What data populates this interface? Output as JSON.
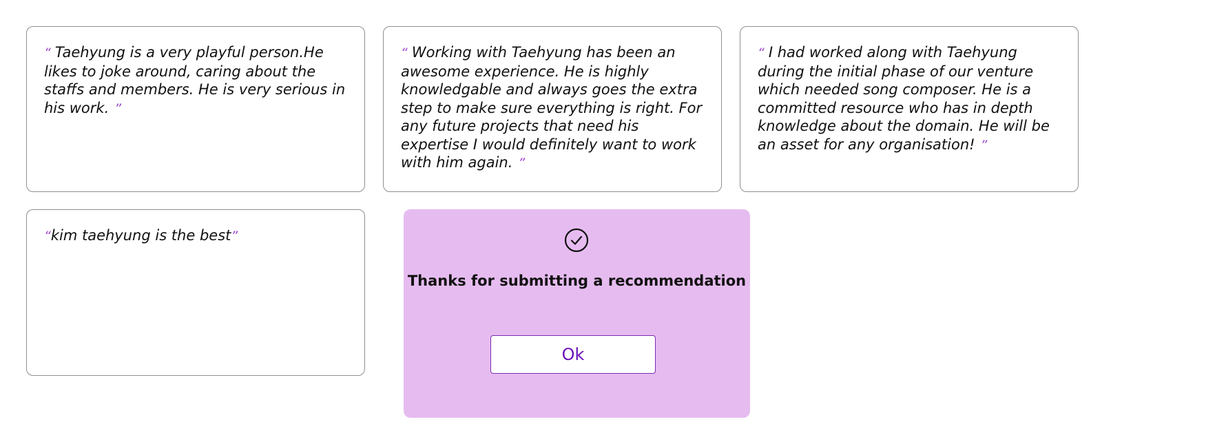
{
  "recommendations": [
    {
      "open_quote": "“",
      "text": "Taehyung is a very playful person.He likes to joke around, caring about the staffs and members. He is very serious in his work.",
      "close_quote": "”"
    },
    {
      "open_quote": "“",
      "text": "Working with Taehyung has been an awesome experience. He is highly knowledgable and always goes the extra step to make sure everything is right. For any future projects that need his expertise I would definitely want to work with him again.",
      "close_quote": "”"
    },
    {
      "open_quote": "“",
      "text": "I had worked along with Taehyung during the initial phase of our venture which needed song composer. He is a committed resource who has in depth knowledge about the domain. He will be an asset for any organisation!",
      "close_quote": "”"
    },
    {
      "open_quote": "“",
      "text": "kim taehyung is the best",
      "close_quote": "”"
    }
  ],
  "modal": {
    "icon": "check-circle-icon",
    "title": "Thanks for submitting a recommendation",
    "ok_label": "Ok"
  },
  "colors": {
    "modal_background": "#e6bcf0",
    "quote_mark": "#a24ad2",
    "accent": "#6a12b8",
    "card_border": "#8f8f8f"
  }
}
